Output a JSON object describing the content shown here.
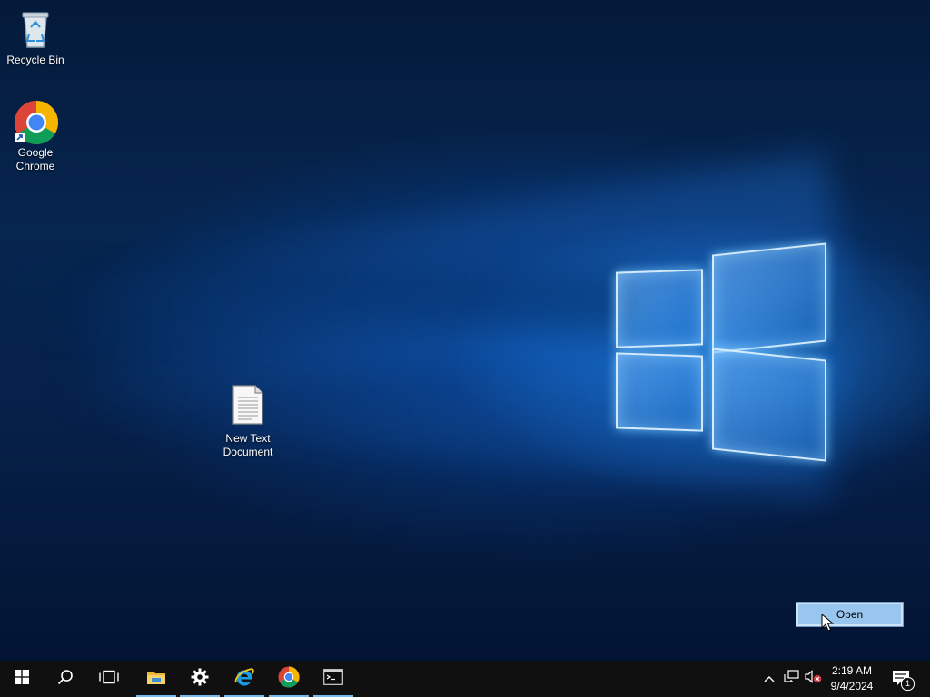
{
  "desktop": {
    "icons": [
      {
        "label": "Recycle Bin",
        "icon": "recycle-bin-icon"
      },
      {
        "label": "Google\nChrome",
        "icon": "chrome-icon"
      },
      {
        "label": "New Text\nDocument",
        "icon": "text-document-icon"
      }
    ],
    "context_item": {
      "label": "Open"
    }
  },
  "taskbar": {
    "buttons": [
      {
        "icon": "windows-start-icon"
      },
      {
        "icon": "search-icon"
      },
      {
        "icon": "task-view-icon"
      },
      {
        "icon": "file-explorer-icon"
      },
      {
        "icon": "settings-gear-icon"
      },
      {
        "icon": "internet-explorer-icon"
      },
      {
        "icon": "chrome-icon"
      },
      {
        "icon": "command-prompt-icon"
      }
    ],
    "tray": {
      "icons": [
        "chevron-up-icon",
        "network-icon",
        "volume-muted-icon"
      ],
      "time": "2:19 AM",
      "date": "9/4/2024",
      "notification_count": "1"
    }
  },
  "colors": {
    "taskbar": "#101010",
    "active_indicator": "#76b9ed",
    "selection": "#99c6ee"
  }
}
